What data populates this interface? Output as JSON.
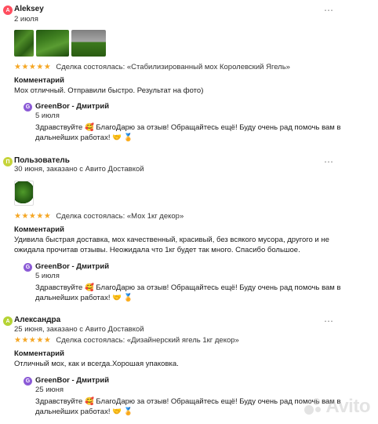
{
  "reviews": [
    {
      "initial": "A",
      "avatar_color": "#ff4d5e",
      "name": "Aleksey",
      "date": "2 июля",
      "stars": "★★★★★",
      "deal": "Сделка состоялась: «Стабилизированный мох Королевский Ягель»",
      "comment_label": "Комментарий",
      "comment": "Мох отличный. Отправили быстро. Результат на фото)",
      "reply": {
        "initial": "G",
        "name": "GreenBor - Дмитрий",
        "date": "5 июля",
        "text": "Здравствуйте 🥰 БлагоДарю за отзыв! Обращайтесь ещё! Буду очень рад помочь вам в дальнейших работах! 🤝 🏅"
      }
    },
    {
      "initial": "П",
      "avatar_color": "#c6d43a",
      "name": "Пользователь",
      "date": "30 июня, заказано с Авито Доставкой",
      "stars": "★★★★★",
      "deal": "Сделка состоялась: «Мох 1кг декор»",
      "comment_label": "Комментарий",
      "comment": "Удивила быстрая доставка, мох качественный, красивый, без всякого мусора, другого и не ожидала прочитав отзывы. Неожидала что 1кг будет так много. Спасибо большое.",
      "reply": {
        "initial": "G",
        "name": "GreenBor - Дмитрий",
        "date": "5 июля",
        "text": "Здравствуйте 🥰 БлагоДарю за отзыв! Обращайтесь ещё! Буду очень рад помочь вам в дальнейших работах! 🤝 🏅"
      }
    },
    {
      "initial": "A",
      "avatar_color": "#b5d334",
      "name": "Александра",
      "date": "25 июня, заказано с Авито Доставкой",
      "stars": "★★★★★",
      "deal": "Сделка состоялась: «Дизайнерский ягель 1кг декор»",
      "comment_label": "Комментарий",
      "comment": "Отличный мох, как и всегда.Хорошая упаковка.",
      "reply": {
        "initial": "G",
        "name": "GreenBor - Дмитрий",
        "date": "25 июня",
        "text": "Здравствуйте 🥰 БлагоДарю за отзыв! Обращайтесь ещё! Буду очень рад помочь вам в дальнейших работах! 🤝 🏅"
      }
    }
  ],
  "more_icon": "⋯",
  "watermark": "Avito",
  "colors": {
    "stars": "#f5a623",
    "reply_avatar": "#8b5ad6"
  }
}
